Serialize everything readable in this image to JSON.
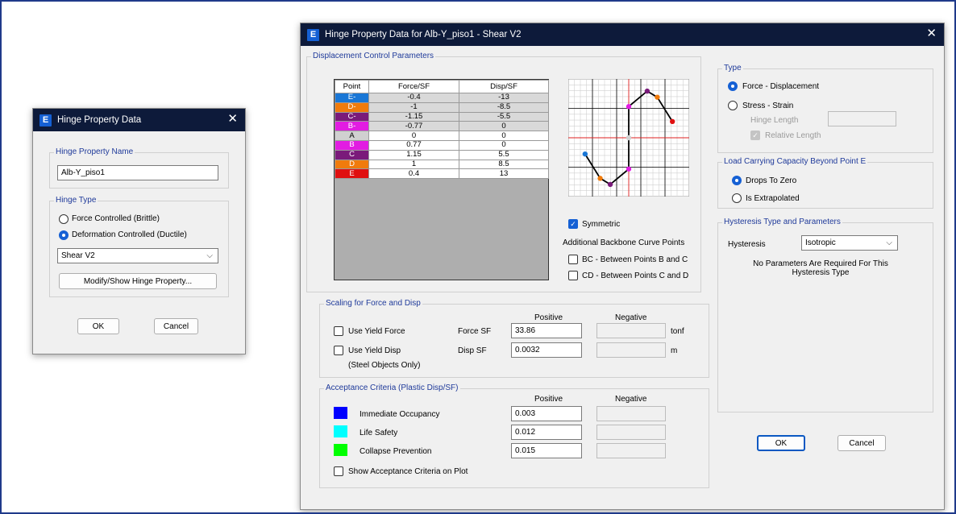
{
  "small_dialog": {
    "title": "Hinge Property Data",
    "close_glyph": "✕",
    "hinge_name_group": "Hinge Property Name",
    "hinge_name_value": "Alb-Y_piso1",
    "hinge_type_group": "Hinge Type",
    "opt_force": "Force Controlled  (Brittle)",
    "opt_deform": "Deformation Controlled  (Ductile)",
    "dof_select": "Shear V2",
    "modify_button": "Modify/Show Hinge Property...",
    "ok": "OK",
    "cancel": "Cancel"
  },
  "main_dialog": {
    "title": "Hinge Property Data for Alb-Y_piso1 - Shear V2",
    "close_glyph": "✕",
    "disp_group": "Displacement Control Parameters",
    "table": {
      "headers": [
        "Point",
        "Force/SF",
        "Disp/SF"
      ],
      "rows": [
        {
          "point": "E-",
          "force": "-0.4",
          "disp": "-13",
          "color": "#1a77d6"
        },
        {
          "point": "D-",
          "force": "-1",
          "disp": "-8.5",
          "color": "#f07b0c"
        },
        {
          "point": "C-",
          "force": "-1.15",
          "disp": "-5.5",
          "color": "#7a1a7a"
        },
        {
          "point": "B-",
          "force": "-0.77",
          "disp": "0",
          "color": "#e21ce2"
        },
        {
          "point": "A",
          "force": "0",
          "disp": "0",
          "color": "#d0d0d0"
        },
        {
          "point": "B",
          "force": "0.77",
          "disp": "0",
          "color": "#e21ce2"
        },
        {
          "point": "C",
          "force": "1.15",
          "disp": "5.5",
          "color": "#7a1a7a"
        },
        {
          "point": "D",
          "force": "1",
          "disp": "8.5",
          "color": "#f07b0c"
        },
        {
          "point": "E",
          "force": "0.4",
          "disp": "13",
          "color": "#e01010"
        }
      ]
    },
    "symmetric": "Symmetric",
    "additional_points": "Additional Backbone Curve Points",
    "bc_points": "BC - Between Points B and C",
    "cd_points": "CD - Between Points C and D",
    "type_group": "Type",
    "opt_force_disp": "Force - Displacement",
    "opt_stress_strain": "Stress - Strain",
    "hinge_length": "Hinge Length",
    "relative_length": "Relative Length",
    "load_group": "Load Carrying Capacity Beyond Point E",
    "drops_to_zero": "Drops To Zero",
    "is_extrapolated": "Is Extrapolated",
    "hyst_group": "Hysteresis Type and Parameters",
    "hysteresis_label": "Hysteresis",
    "hysteresis_value": "Isotropic",
    "hyst_note": "No Parameters Are Required For This Hysteresis Type",
    "scaling_group": "Scaling for Force and Disp",
    "positive": "Positive",
    "negative": "Negative",
    "use_yield_force": "Use Yield Force",
    "force_sf": "Force SF",
    "force_sf_value": "33.86",
    "force_unit": "tonf",
    "use_yield_disp": "Use Yield Disp",
    "disp_sf": "Disp SF",
    "disp_sf_value": "0.0032",
    "disp_unit": "m",
    "steel_only": "(Steel Objects Only)",
    "accept_group": "Acceptance Criteria (Plastic Disp/SF)",
    "io_label": "Immediate Occupancy",
    "io_value": "0.003",
    "io_color": "#0000ff",
    "ls_label": "Life Safety",
    "ls_value": "0.012",
    "ls_color": "#00ffff",
    "cp_label": "Collapse Prevention",
    "cp_value": "0.015",
    "cp_color": "#00ff00",
    "show_accept": "Show Acceptance Criteria on Plot",
    "ok": "OK",
    "cancel": "Cancel"
  }
}
